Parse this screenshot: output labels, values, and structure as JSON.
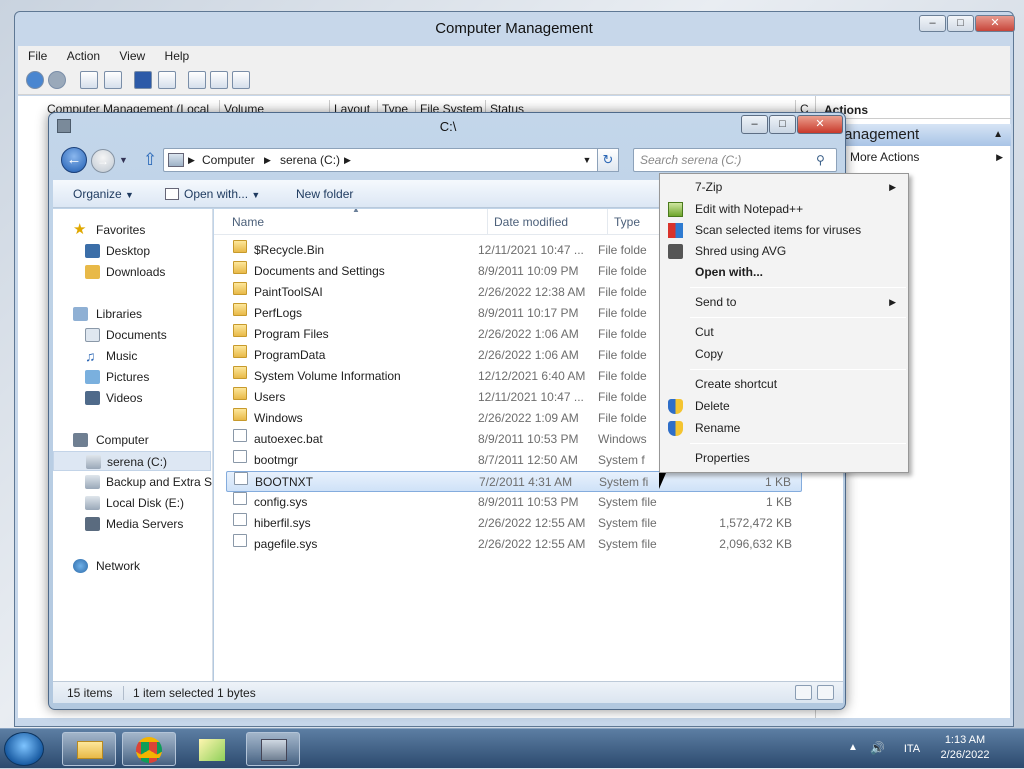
{
  "cm": {
    "title": "Computer Management",
    "menu": [
      "File",
      "Action",
      "View",
      "Help"
    ],
    "tree_root": "Computer Management (Local",
    "columns": [
      "Volume",
      "Layout",
      "Type",
      "File System",
      "Status",
      "C"
    ],
    "actions_header": "Actions",
    "actions_section": "k Management",
    "more_actions": "More Actions"
  },
  "explorer": {
    "title": "C:\\",
    "breadcrumb": [
      "Computer",
      "serena (C:)"
    ],
    "search_placeholder": "Search serena (C:)",
    "commands": {
      "organize": "Organize",
      "open_with": "Open with...",
      "new_folder": "New folder"
    },
    "nav": {
      "favorites": "Favorites",
      "desktop": "Desktop",
      "downloads": "Downloads",
      "libraries": "Libraries",
      "documents": "Documents",
      "music": "Music",
      "pictures": "Pictures",
      "videos": "Videos",
      "computer": "Computer",
      "serena": "serena (C:)",
      "backup": "Backup and Extra St",
      "local_e": "Local Disk (E:)",
      "media": "Media Servers",
      "network": "Network"
    },
    "columns": {
      "name": "Name",
      "date": "Date modified",
      "type": "Type"
    },
    "rows": [
      {
        "name": "$Recycle.Bin",
        "date": "12/11/2021 10:47 ...",
        "type": "File folde",
        "size": ""
      },
      {
        "name": "Documents and Settings",
        "date": "8/9/2011 10:09 PM",
        "type": "File folde",
        "size": ""
      },
      {
        "name": "PaintToolSAI",
        "date": "2/26/2022 12:38 AM",
        "type": "File folde",
        "size": ""
      },
      {
        "name": "PerfLogs",
        "date": "8/9/2011 10:17 PM",
        "type": "File folde",
        "size": ""
      },
      {
        "name": "Program Files",
        "date": "2/26/2022 1:06 AM",
        "type": "File folde",
        "size": ""
      },
      {
        "name": "ProgramData",
        "date": "2/26/2022 1:06 AM",
        "type": "File folde",
        "size": ""
      },
      {
        "name": "System Volume Information",
        "date": "12/12/2021 6:40 AM",
        "type": "File folde",
        "size": ""
      },
      {
        "name": "Users",
        "date": "12/11/2021 10:47 ...",
        "type": "File folde",
        "size": ""
      },
      {
        "name": "Windows",
        "date": "2/26/2022 1:09 AM",
        "type": "File folde",
        "size": ""
      },
      {
        "name": "autoexec.bat",
        "date": "8/9/2011 10:53 PM",
        "type": "Windows",
        "size": ""
      },
      {
        "name": "bootmgr",
        "date": "8/7/2011 12:50 AM",
        "type": "System f",
        "size": ""
      },
      {
        "name": "BOOTNXT",
        "date": "7/2/2011 4:31 AM",
        "type": "System fi",
        "size": "1 KB"
      },
      {
        "name": "config.sys",
        "date": "8/9/2011 10:53 PM",
        "type": "System file",
        "size": "1 KB"
      },
      {
        "name": "hiberfil.sys",
        "date": "2/26/2022 12:55 AM",
        "type": "System file",
        "size": "1,572,472 KB"
      },
      {
        "name": "pagefile.sys",
        "date": "2/26/2022 12:55 AM",
        "type": "System file",
        "size": "2,096,632 KB"
      }
    ],
    "status_items": "15 items",
    "status_selected": "1 item selected  1 bytes"
  },
  "context_menu": {
    "zip": "7-Zip",
    "notepad": "Edit with Notepad++",
    "scan": "Scan selected items for viruses",
    "shred": "Shred using AVG",
    "open_with": "Open with...",
    "send_to": "Send to",
    "cut": "Cut",
    "copy": "Copy",
    "shortcut": "Create shortcut",
    "delete": "Delete",
    "rename": "Rename",
    "properties": "Properties"
  },
  "taskbar": {
    "lang": "ITA",
    "time": "1:13 AM",
    "date": "2/26/2022"
  },
  "colors": {
    "accent": "#1e5cb1",
    "selection": "#cfe2f8",
    "folder": "#e8b948"
  }
}
